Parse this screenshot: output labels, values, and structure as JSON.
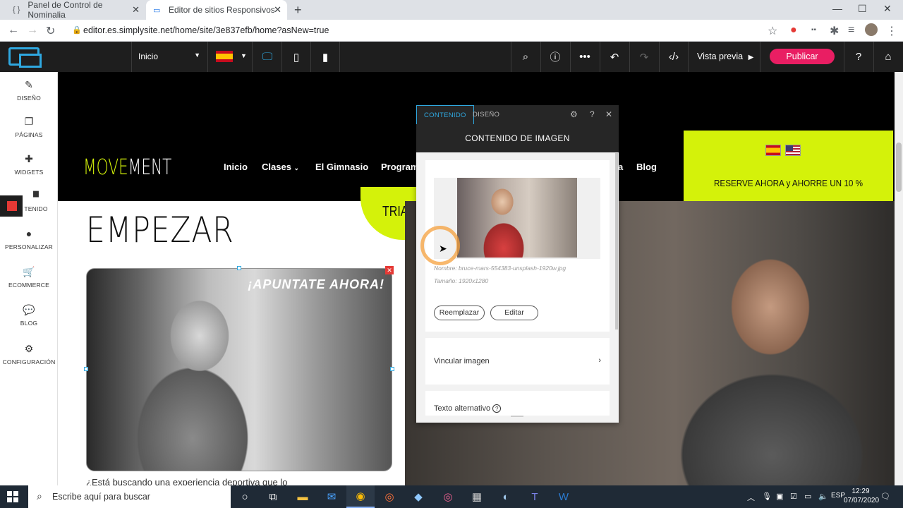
{
  "browser": {
    "tabs": [
      {
        "label": "Panel de Control de Nominalia",
        "icon": "{ }"
      },
      {
        "label": "Editor de sitios Responsivos",
        "icon": "▭"
      }
    ],
    "url": "editor.es.simplysite.net/home/site/3e837efb/home?asNew=true"
  },
  "editor": {
    "page_select": "Inicio",
    "preview_label": "Vista previa",
    "publish_label": "Publicar",
    "sidebar": [
      {
        "label": "DISEÑO",
        "icon": "pencil-icon",
        "glyph": "✎"
      },
      {
        "label": "PÁGINAS",
        "icon": "pages-icon",
        "glyph": "❐"
      },
      {
        "label": "WIDGETS",
        "icon": "plus-icon",
        "glyph": "✚"
      },
      {
        "label": "TENIDO",
        "icon": "folder-icon",
        "glyph": "▆"
      },
      {
        "label": "PERSONALIZAR",
        "icon": "user-icon",
        "glyph": "●"
      },
      {
        "label": "ECOMMERCE",
        "icon": "cart-icon",
        "glyph": "🛒"
      },
      {
        "label": "BLOG",
        "icon": "chat-icon",
        "glyph": "💬"
      },
      {
        "label": "CONFIGURACIÓN",
        "icon": "gear-icon",
        "glyph": "⚙"
      }
    ]
  },
  "site": {
    "brand_a": "MOVE",
    "brand_b": "MENT",
    "menu": [
      "Inicio",
      "Clases",
      "El Gimnasio",
      "Program",
      "a",
      "Blog"
    ],
    "cta": "RESERVE AHORA y AHORRE UN 10 %",
    "trial": "TRIAL",
    "heading": "EMPEZAR",
    "image_caption": "¡APUNTATE AHORA!",
    "paragraph": "¿Está buscando una experiencia deportiva que lo"
  },
  "panel": {
    "tab_content": "CONTENIDO",
    "tab_design": "DISEÑO",
    "title": "CONTENIDO DE IMAGEN",
    "file_name": "Nombre: bruce-mars-554383-unsplash-1920w.jpg",
    "file_size": "Tamaño: 1920x1280",
    "replace_label": "Reemplazar",
    "edit_label": "Editar",
    "link_label": "Vincular imagen",
    "alt_label": "Texto alternativo"
  },
  "taskbar": {
    "search_placeholder": "Escribe aquí para buscar",
    "time": "12:29",
    "date": "07/07/2020"
  },
  "colors": {
    "accent": "#2fa8e0",
    "publish": "#e91e63",
    "lime": "#d4f20a",
    "dark": "#1e1e1e"
  }
}
